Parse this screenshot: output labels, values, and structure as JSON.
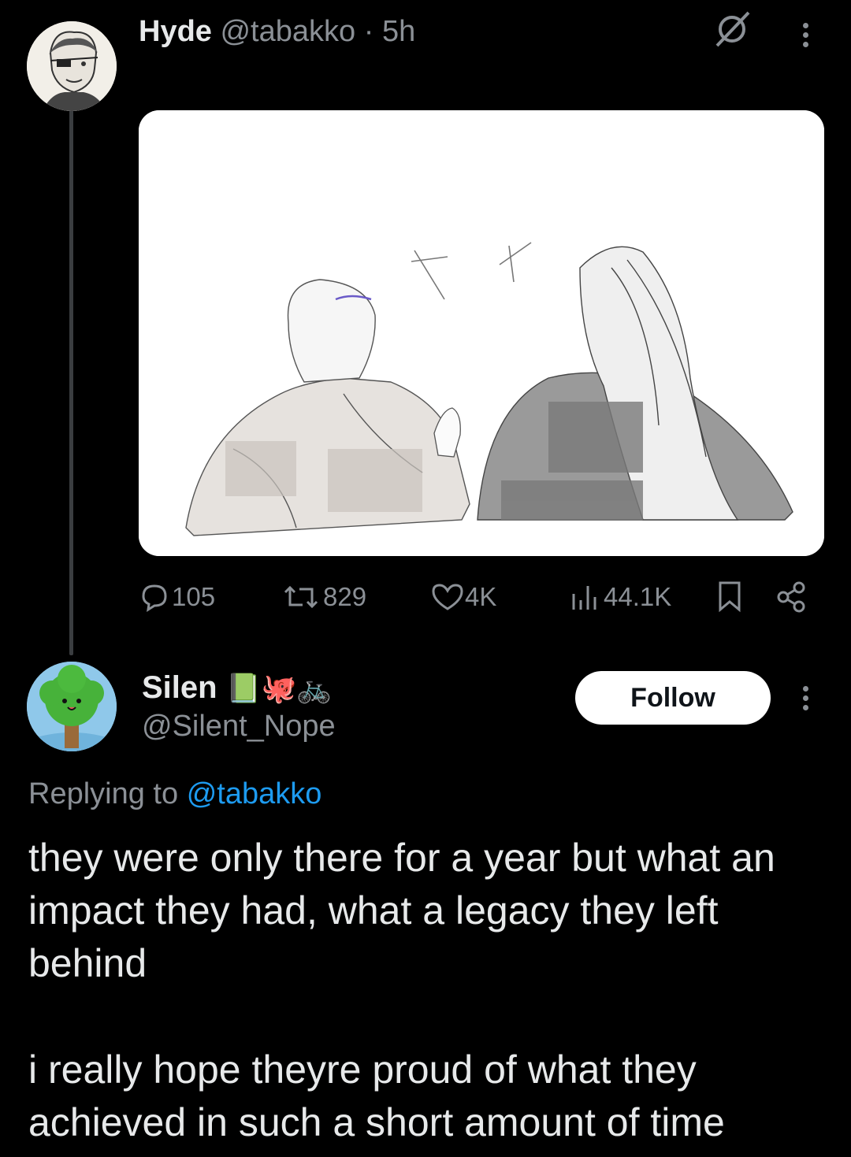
{
  "tweet": {
    "author_name": "Hyde",
    "author_handle": "@tabakko",
    "separator": "·",
    "time": "5h",
    "stats": {
      "replies": "105",
      "reposts": "829",
      "likes": "4K",
      "views": "44.1K"
    }
  },
  "reply": {
    "author_name": "Silen",
    "author_emojis": "📗🐙🚲",
    "author_handle": "@Silent_Nope",
    "follow_label": "Follow",
    "replying_prefix": "Replying to",
    "replying_handle": "@tabakko",
    "paragraph1": "they were only there for a year but what an impact they had, what a legacy they left behind",
    "paragraph2": "i really hope theyre proud of what they achieved in such a short amount of time"
  },
  "icons": [
    "grok-icon",
    "more-icon",
    "reply-icon",
    "repost-icon",
    "like-icon",
    "views-icon",
    "bookmark-icon",
    "share-icon"
  ],
  "colors": {
    "background": "#000000",
    "text": "#e7e9ea",
    "muted": "#8b9096",
    "link": "#1d9bf0"
  }
}
